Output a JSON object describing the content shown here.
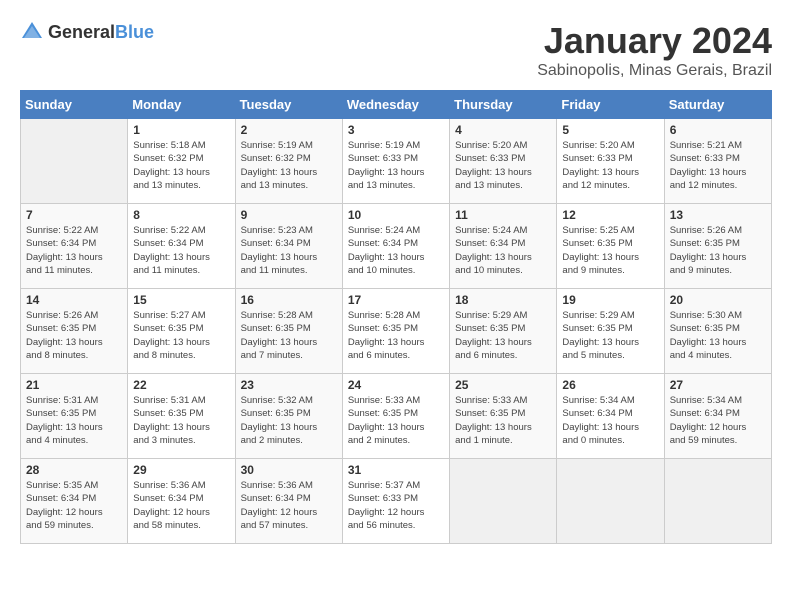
{
  "header": {
    "logo_general": "General",
    "logo_blue": "Blue",
    "month_title": "January 2024",
    "subtitle": "Sabinopolis, Minas Gerais, Brazil"
  },
  "weekdays": [
    "Sunday",
    "Monday",
    "Tuesday",
    "Wednesday",
    "Thursday",
    "Friday",
    "Saturday"
  ],
  "weeks": [
    [
      {
        "day": "",
        "detail": ""
      },
      {
        "day": "1",
        "detail": "Sunrise: 5:18 AM\nSunset: 6:32 PM\nDaylight: 13 hours\nand 13 minutes."
      },
      {
        "day": "2",
        "detail": "Sunrise: 5:19 AM\nSunset: 6:32 PM\nDaylight: 13 hours\nand 13 minutes."
      },
      {
        "day": "3",
        "detail": "Sunrise: 5:19 AM\nSunset: 6:33 PM\nDaylight: 13 hours\nand 13 minutes."
      },
      {
        "day": "4",
        "detail": "Sunrise: 5:20 AM\nSunset: 6:33 PM\nDaylight: 13 hours\nand 13 minutes."
      },
      {
        "day": "5",
        "detail": "Sunrise: 5:20 AM\nSunset: 6:33 PM\nDaylight: 13 hours\nand 12 minutes."
      },
      {
        "day": "6",
        "detail": "Sunrise: 5:21 AM\nSunset: 6:33 PM\nDaylight: 13 hours\nand 12 minutes."
      }
    ],
    [
      {
        "day": "7",
        "detail": "Sunrise: 5:22 AM\nSunset: 6:34 PM\nDaylight: 13 hours\nand 11 minutes."
      },
      {
        "day": "8",
        "detail": "Sunrise: 5:22 AM\nSunset: 6:34 PM\nDaylight: 13 hours\nand 11 minutes."
      },
      {
        "day": "9",
        "detail": "Sunrise: 5:23 AM\nSunset: 6:34 PM\nDaylight: 13 hours\nand 11 minutes."
      },
      {
        "day": "10",
        "detail": "Sunrise: 5:24 AM\nSunset: 6:34 PM\nDaylight: 13 hours\nand 10 minutes."
      },
      {
        "day": "11",
        "detail": "Sunrise: 5:24 AM\nSunset: 6:34 PM\nDaylight: 13 hours\nand 10 minutes."
      },
      {
        "day": "12",
        "detail": "Sunrise: 5:25 AM\nSunset: 6:35 PM\nDaylight: 13 hours\nand 9 minutes."
      },
      {
        "day": "13",
        "detail": "Sunrise: 5:26 AM\nSunset: 6:35 PM\nDaylight: 13 hours\nand 9 minutes."
      }
    ],
    [
      {
        "day": "14",
        "detail": "Sunrise: 5:26 AM\nSunset: 6:35 PM\nDaylight: 13 hours\nand 8 minutes."
      },
      {
        "day": "15",
        "detail": "Sunrise: 5:27 AM\nSunset: 6:35 PM\nDaylight: 13 hours\nand 8 minutes."
      },
      {
        "day": "16",
        "detail": "Sunrise: 5:28 AM\nSunset: 6:35 PM\nDaylight: 13 hours\nand 7 minutes."
      },
      {
        "day": "17",
        "detail": "Sunrise: 5:28 AM\nSunset: 6:35 PM\nDaylight: 13 hours\nand 6 minutes."
      },
      {
        "day": "18",
        "detail": "Sunrise: 5:29 AM\nSunset: 6:35 PM\nDaylight: 13 hours\nand 6 minutes."
      },
      {
        "day": "19",
        "detail": "Sunrise: 5:29 AM\nSunset: 6:35 PM\nDaylight: 13 hours\nand 5 minutes."
      },
      {
        "day": "20",
        "detail": "Sunrise: 5:30 AM\nSunset: 6:35 PM\nDaylight: 13 hours\nand 4 minutes."
      }
    ],
    [
      {
        "day": "21",
        "detail": "Sunrise: 5:31 AM\nSunset: 6:35 PM\nDaylight: 13 hours\nand 4 minutes."
      },
      {
        "day": "22",
        "detail": "Sunrise: 5:31 AM\nSunset: 6:35 PM\nDaylight: 13 hours\nand 3 minutes."
      },
      {
        "day": "23",
        "detail": "Sunrise: 5:32 AM\nSunset: 6:35 PM\nDaylight: 13 hours\nand 2 minutes."
      },
      {
        "day": "24",
        "detail": "Sunrise: 5:33 AM\nSunset: 6:35 PM\nDaylight: 13 hours\nand 2 minutes."
      },
      {
        "day": "25",
        "detail": "Sunrise: 5:33 AM\nSunset: 6:35 PM\nDaylight: 13 hours\nand 1 minute."
      },
      {
        "day": "26",
        "detail": "Sunrise: 5:34 AM\nSunset: 6:34 PM\nDaylight: 13 hours\nand 0 minutes."
      },
      {
        "day": "27",
        "detail": "Sunrise: 5:34 AM\nSunset: 6:34 PM\nDaylight: 12 hours\nand 59 minutes."
      }
    ],
    [
      {
        "day": "28",
        "detail": "Sunrise: 5:35 AM\nSunset: 6:34 PM\nDaylight: 12 hours\nand 59 minutes."
      },
      {
        "day": "29",
        "detail": "Sunrise: 5:36 AM\nSunset: 6:34 PM\nDaylight: 12 hours\nand 58 minutes."
      },
      {
        "day": "30",
        "detail": "Sunrise: 5:36 AM\nSunset: 6:34 PM\nDaylight: 12 hours\nand 57 minutes."
      },
      {
        "day": "31",
        "detail": "Sunrise: 5:37 AM\nSunset: 6:33 PM\nDaylight: 12 hours\nand 56 minutes."
      },
      {
        "day": "",
        "detail": ""
      },
      {
        "day": "",
        "detail": ""
      },
      {
        "day": "",
        "detail": ""
      }
    ]
  ]
}
